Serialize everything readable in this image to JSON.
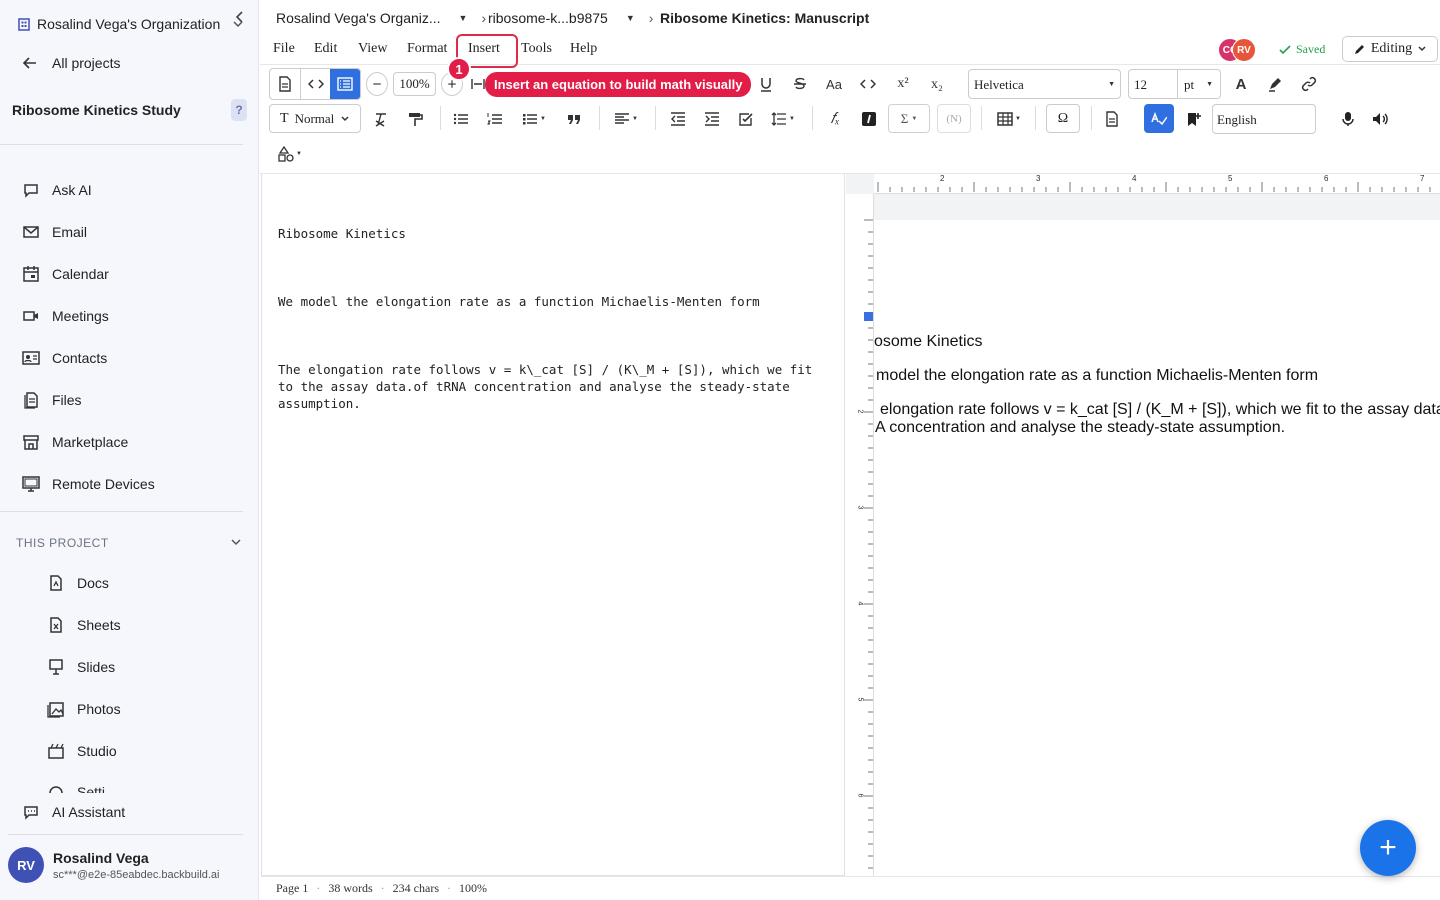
{
  "sidebar": {
    "org_name": "Rosalind Vega's Organization",
    "all_projects": "All projects",
    "project_name": "Ribosome Kinetics Study",
    "help_label": "?",
    "nav": [
      {
        "label": "Ask AI",
        "icon": "chat-icon"
      },
      {
        "label": "Email",
        "icon": "mail-icon"
      },
      {
        "label": "Calendar",
        "icon": "calendar-icon"
      },
      {
        "label": "Meetings",
        "icon": "video-icon"
      },
      {
        "label": "Contacts",
        "icon": "contacts-icon"
      },
      {
        "label": "Files",
        "icon": "files-icon"
      },
      {
        "label": "Marketplace",
        "icon": "store-icon"
      },
      {
        "label": "Remote Devices",
        "icon": "monitor-icon"
      }
    ],
    "section_title": "THIS PROJECT",
    "project_items": [
      {
        "label": "Docs",
        "icon": "doc-icon"
      },
      {
        "label": "Sheets",
        "icon": "sheet-icon"
      },
      {
        "label": "Slides",
        "icon": "slides-icon"
      },
      {
        "label": "Photos",
        "icon": "photo-icon"
      },
      {
        "label": "Studio",
        "icon": "studio-icon"
      },
      {
        "label": "Setti",
        "icon": "settings-icon"
      }
    ],
    "ai_assistant": "AI Assistant",
    "user": {
      "initials": "RV",
      "name": "Rosalind Vega",
      "email": "sc***@e2e-85eabdec.backbuild.ai"
    }
  },
  "breadcrumb": {
    "org": "Rosalind Vega's Organiz...",
    "project": "ribosome-k...b9875",
    "doc": "Ribosome Kinetics: Manuscript"
  },
  "menu": [
    "File",
    "Edit",
    "View",
    "Format",
    "Insert",
    "Tools",
    "Help"
  ],
  "annotation": {
    "badge": "1",
    "tooltip": "Insert an equation to build math visually"
  },
  "collaborators": [
    {
      "initials": "CC",
      "color": "#d6336c"
    },
    {
      "initials": "RV",
      "color": "#e8553b"
    }
  ],
  "save_status": "Saved",
  "mode": "Editing",
  "toolbar": {
    "zoom": "100%",
    "font": "Helvetica",
    "size": "12",
    "size_unit": "pt",
    "style": "Normal",
    "language": "English",
    "omega": "Ω",
    "sigma": "Σ",
    "n_label": "(N)",
    "superscript": "x²",
    "subscript": "x₂",
    "font_color": "A",
    "case_label": "Aa"
  },
  "editor": {
    "lines": [
      "Ribosome Kinetics",
      "We model the elongation rate as a function Michaelis-Menten form",
      "The elongation rate follows v = k\\_cat [S] / (K\\_M + [S]), which we fit to the assay data.of tRNA concentration and analyse the steady-state assumption."
    ]
  },
  "preview": {
    "ruler_numbers": [
      "2",
      "3",
      "4",
      "5",
      "6",
      "7"
    ],
    "vruler_numbers": [
      "2",
      "3",
      "4",
      "5",
      "6"
    ],
    "lines": [
      "osome Kinetics",
      "model the elongation rate as a function Michaelis-Menten form",
      "elongation rate follows v = k_cat [S] / (K_M + [S]), which we fit to the assay data",
      "A concentration and analyse the steady-state assumption."
    ]
  },
  "status": {
    "page": "Page 1",
    "words": "38 words",
    "chars": "234 chars",
    "zoom": "100%",
    "dot": "·"
  },
  "fab_label": "+"
}
